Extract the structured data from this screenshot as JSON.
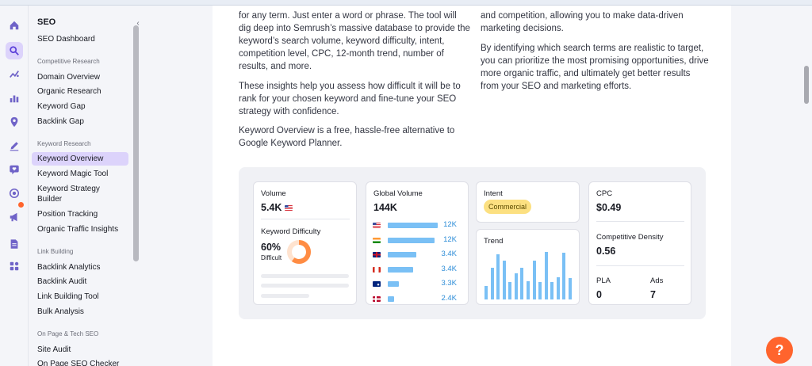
{
  "sidebar": {
    "title": "SEO",
    "dashboard": "SEO Dashboard",
    "sections": [
      {
        "heading": "Competitive Research",
        "items": [
          "Domain Overview",
          "Organic Research",
          "Keyword Gap",
          "Backlink Gap"
        ]
      },
      {
        "heading": "Keyword Research",
        "items": [
          "Keyword Overview",
          "Keyword Magic Tool",
          "Keyword Strategy Builder",
          "Position Tracking",
          "Organic Traffic Insights"
        ]
      },
      {
        "heading": "Link Building",
        "items": [
          "Backlink Analytics",
          "Backlink Audit",
          "Link Building Tool",
          "Bulk Analysis"
        ]
      },
      {
        "heading": "On Page & Tech SEO",
        "items": [
          "Site Audit",
          "On Page SEO Checker"
        ]
      }
    ],
    "selected": "Keyword Overview"
  },
  "rail_icons": [
    "home-icon",
    "seo-icon",
    "sparkle-icon",
    "bar-chart-icon",
    "location-pin-icon",
    "pencil-icon",
    "chat-heart-icon",
    "target-icon",
    "megaphone-icon",
    "document-icon",
    "apps-grid-icon"
  ],
  "article": {
    "left_col": [
      "for any term. Just enter a word or phrase. The tool will dig deep into Semrush’s massive database to provide the keyword’s search volume, keyword difficulty, intent, competition level, CPC, 12-month trend, number of results, and more.",
      "These insights help you assess how difficult it will be to rank for your chosen keyword and fine-tune your SEO strategy with confidence.",
      "Keyword Overview is a free, hassle-free alternative to Google Keyword Planner."
    ],
    "right_col": [
      "and competition, allowing you to make data-driven marketing decisions.",
      "By identifying which search terms are realistic to target, you can prioritize the most promising opportunities, drive more organic traffic, and ultimately get better results from your SEO and marketing efforts."
    ]
  },
  "widget": {
    "volume": {
      "label": "Volume",
      "value": "5.4K",
      "flag": "us-flag-icon"
    },
    "difficulty": {
      "label": "Keyword Difficulty",
      "percent": "60%",
      "level": "Difficult",
      "fraction": 0.6,
      "color": "#ff8c43"
    },
    "global_volume": {
      "label": "Global Volume",
      "value": "144K",
      "rows": [
        {
          "flag": "us-flag-icon",
          "value": "12K",
          "fraction": 0.9
        },
        {
          "flag": "in-flag-icon",
          "value": "12K",
          "fraction": 0.84
        },
        {
          "flag": "uk-flag-icon",
          "value": "3.4K",
          "fraction": 0.52
        },
        {
          "flag": "ca-flag-icon",
          "value": "3.4K",
          "fraction": 0.45
        },
        {
          "flag": "au-flag-icon",
          "value": "3.3K",
          "fraction": 0.2
        },
        {
          "flag": "no-flag-icon",
          "value": "2.4K",
          "fraction": 0.12
        }
      ]
    },
    "intent": {
      "label": "Intent",
      "value": "Commercial"
    },
    "trend": {
      "label": "Trend",
      "values": [
        0.28,
        0.66,
        0.95,
        0.81,
        0.37,
        0.55,
        0.66,
        0.38,
        0.81,
        0.37,
        1.0,
        0.37,
        0.47,
        0.98,
        0.45
      ]
    },
    "cpc": {
      "label": "CPC",
      "value": "$0.49"
    },
    "competitive_density": {
      "label": "Competitive Density",
      "value": "0.56"
    },
    "pla": {
      "label": "PLA",
      "value": "0"
    },
    "ads": {
      "label": "Ads",
      "value": "7"
    }
  },
  "help_button": "?",
  "colors": {
    "accent": "#8f6ef0",
    "selected_bg": "#dcd3fb",
    "bar": "#7ac0f5",
    "value_blue": "#2f8ed8",
    "orange": "#ff642d"
  }
}
